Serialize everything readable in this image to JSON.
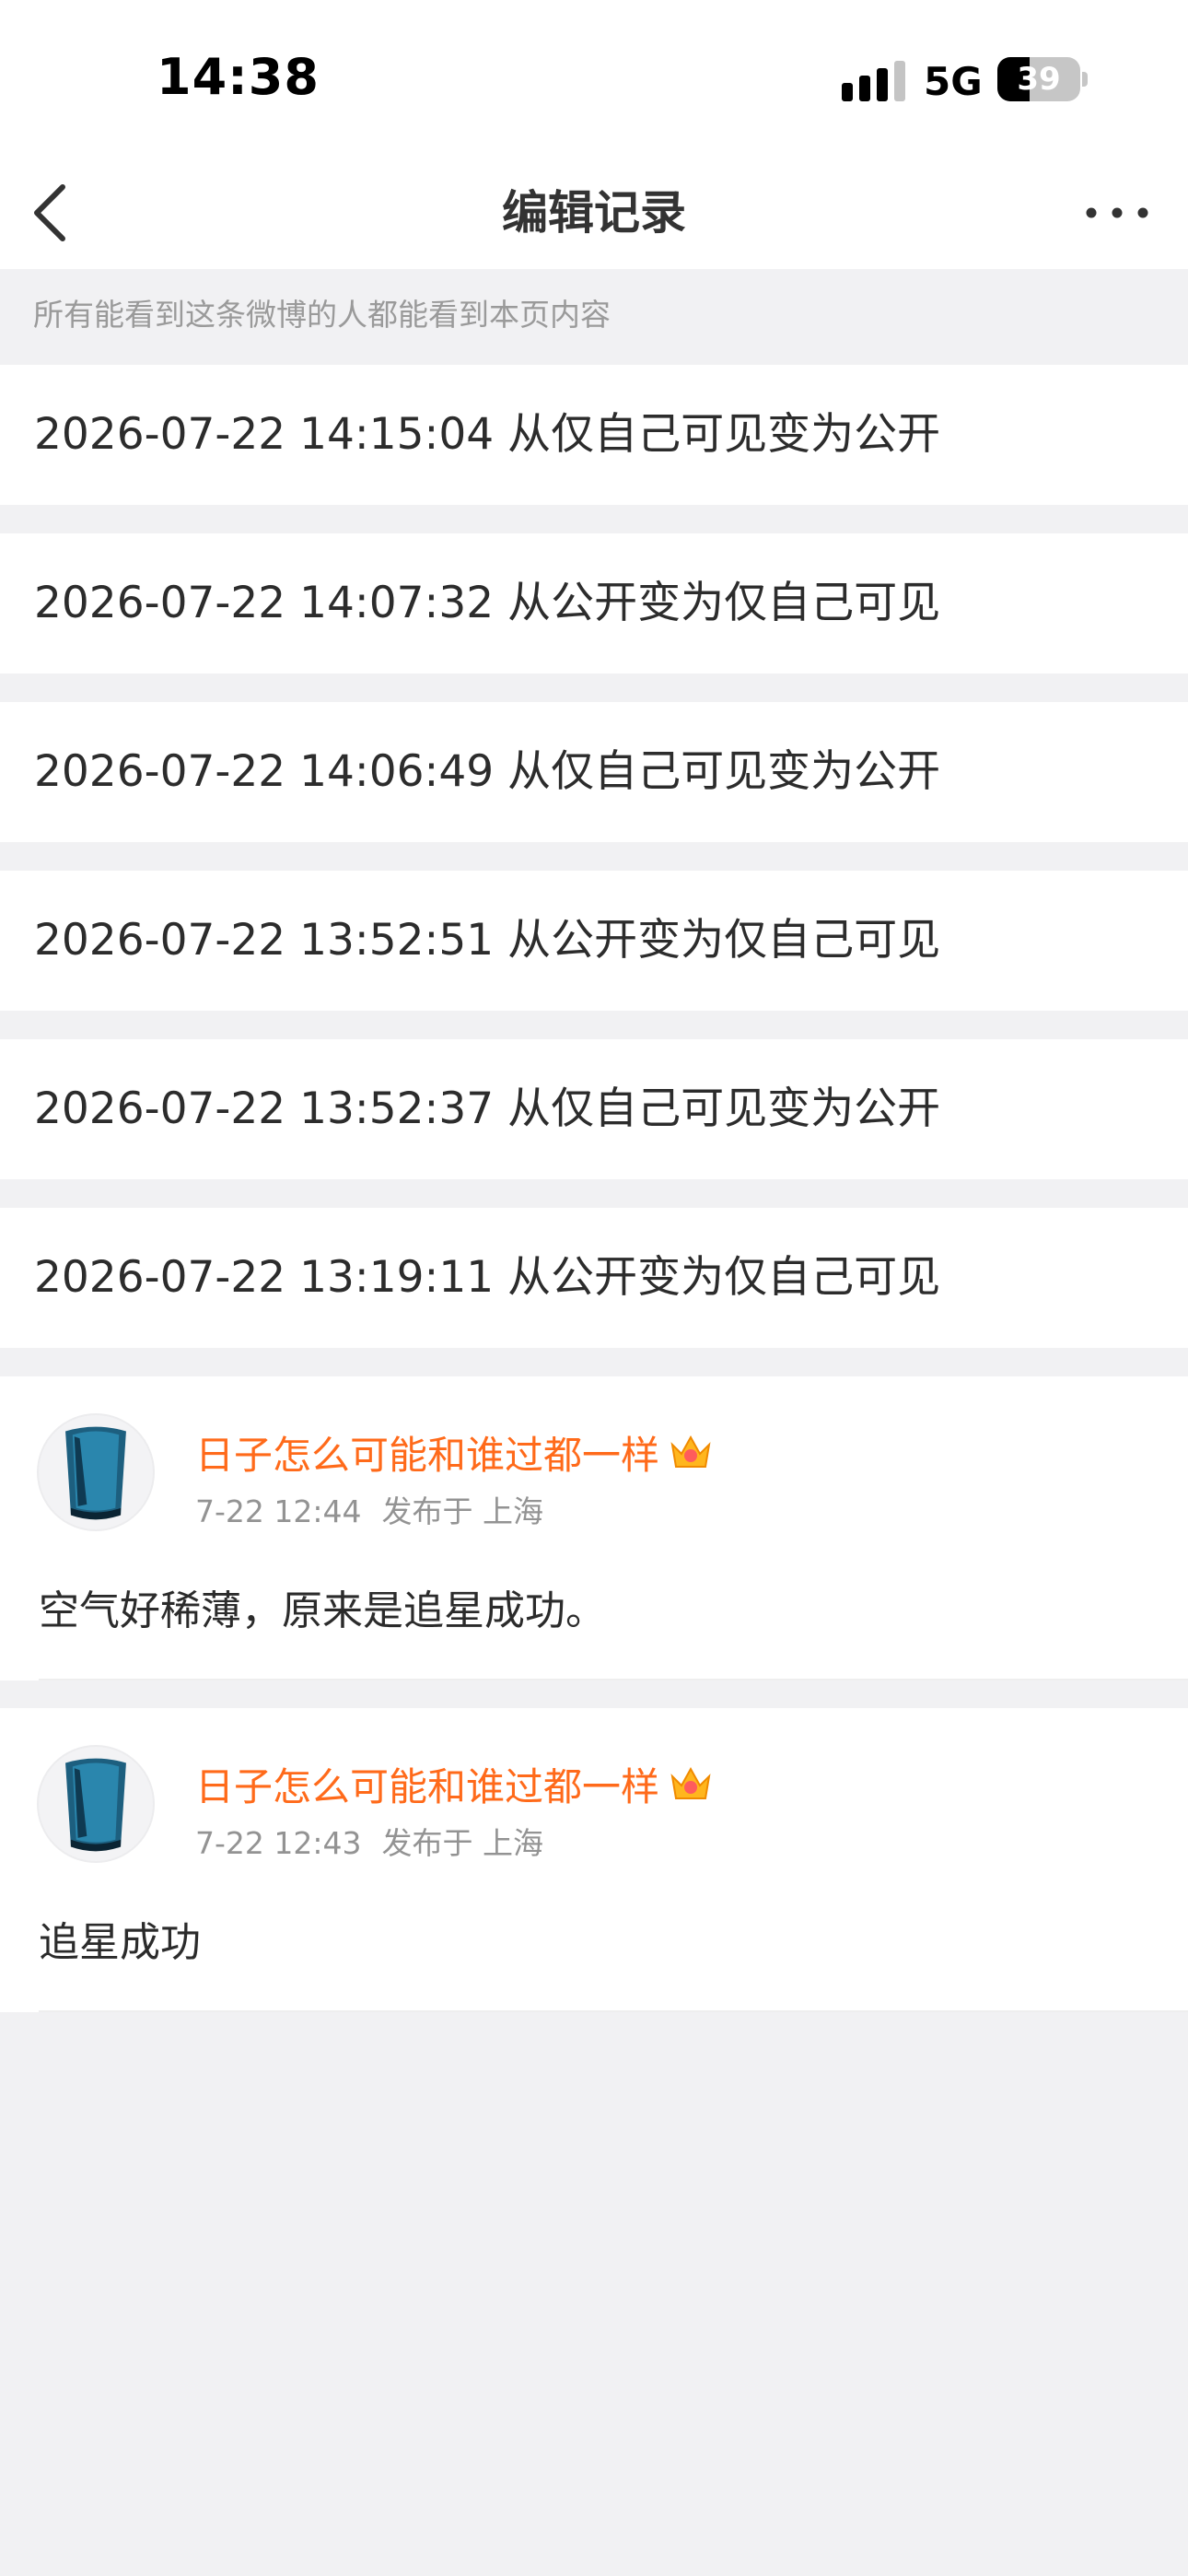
{
  "status_bar": {
    "time": "14:38",
    "network": "5G",
    "battery_level": "39",
    "battery_fraction": 0.39,
    "icons": [
      "signal-icon",
      "battery-icon"
    ]
  },
  "nav": {
    "title": "编辑记录",
    "icons": [
      "back-icon",
      "more-icon"
    ]
  },
  "notice": "所有能看到这条微博的人都能看到本页内容",
  "records": [
    {
      "text": "2026-07-22 14:15:04 从仅自己可见变为公开"
    },
    {
      "text": "2026-07-22 14:07:32 从公开变为仅自己可见"
    },
    {
      "text": "2026-07-22 14:06:49 从仅自己可见变为公开"
    },
    {
      "text": "2026-07-22 13:52:51 从公开变为仅自己可见"
    },
    {
      "text": "2026-07-22 13:52:37 从仅自己可见变为公开"
    },
    {
      "text": "2026-07-22 13:19:11 从公开变为仅自己可见"
    }
  ],
  "posts": [
    {
      "username": "日子怎么可能和谁过都一样",
      "time": "7-22 12:44",
      "location": "发布于 上海",
      "content": "空气好稀薄，原来是追星成功。"
    },
    {
      "username": "日子怎么可能和谁过都一样",
      "time": "7-22 12:43",
      "location": "发布于 上海",
      "content": "追星成功"
    }
  ],
  "colors": {
    "background": "#f1f1f3",
    "username": "#ff6a1a",
    "meta": "#939393"
  }
}
